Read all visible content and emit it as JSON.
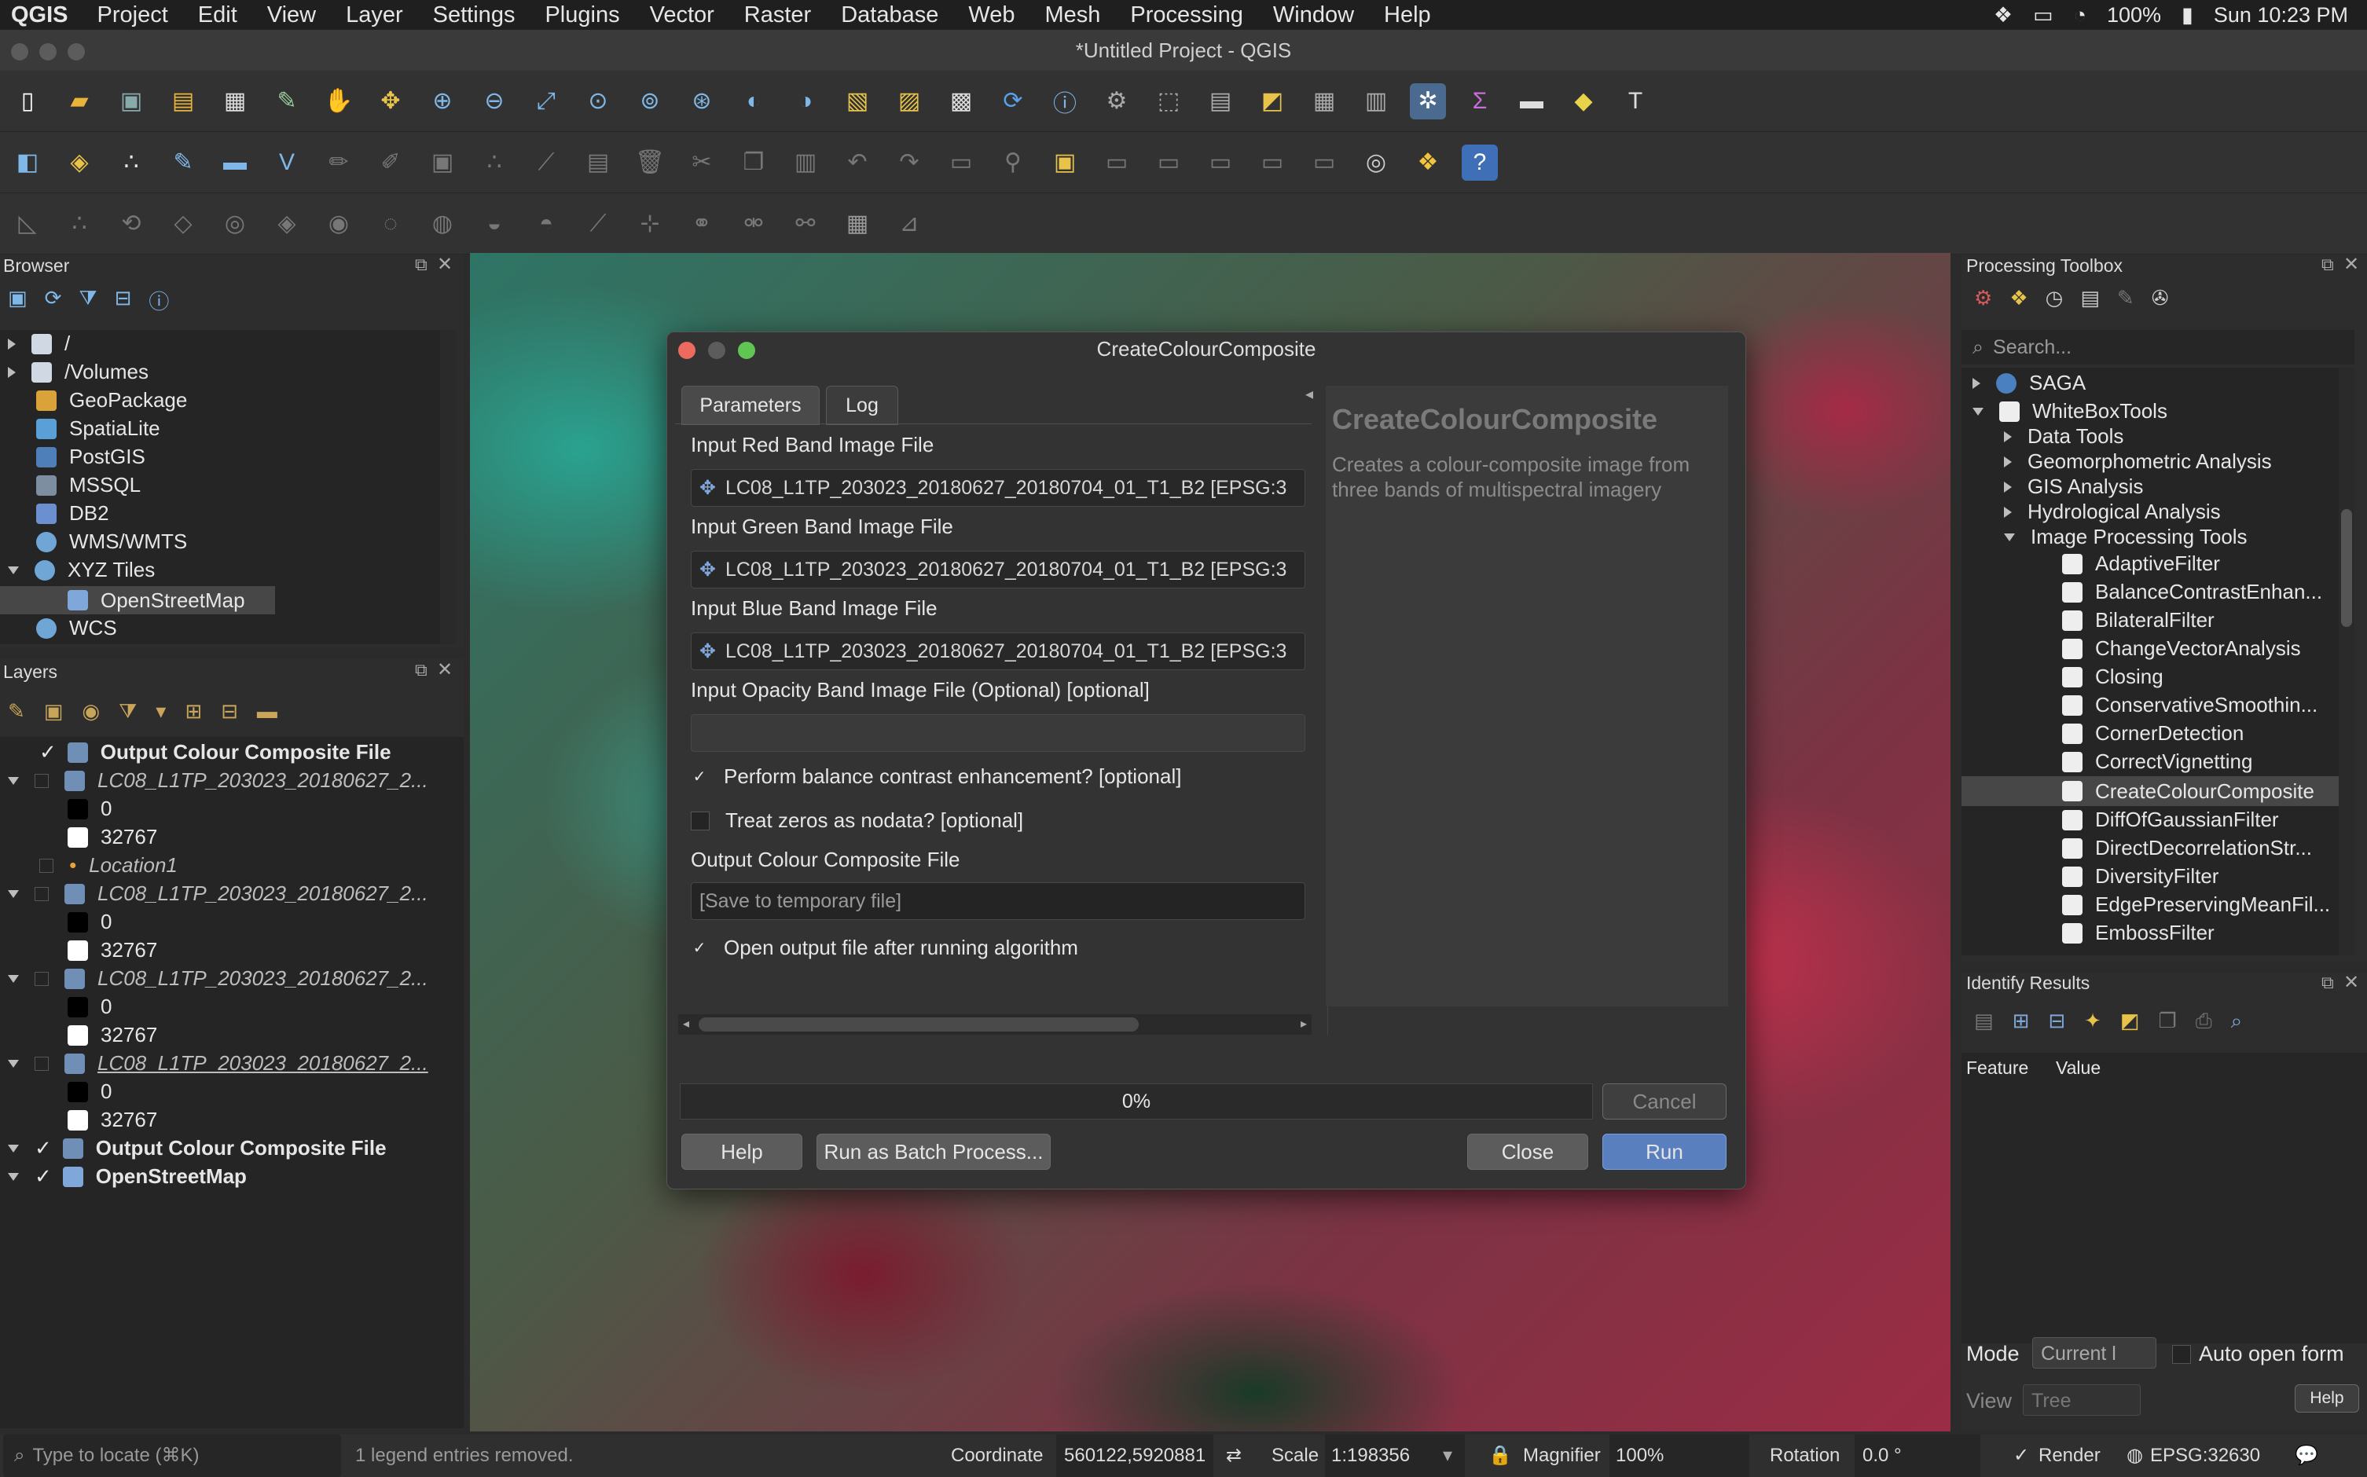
{
  "menubar": {
    "app": "QGIS",
    "items": [
      "Project",
      "Edit",
      "View",
      "Layer",
      "Settings",
      "Plugins",
      "Vector",
      "Raster",
      "Database",
      "Web",
      "Mesh",
      "Processing",
      "Window",
      "Help"
    ],
    "battery": "100%",
    "clock": "Sun 10:23 PM"
  },
  "window": {
    "title": "*Untitled Project - QGIS"
  },
  "browser": {
    "title": "Browser",
    "items": [
      {
        "label": "/",
        "icon": "folder-icon",
        "color": "#cfd8e3"
      },
      {
        "label": "/Volumes",
        "icon": "folder-icon",
        "color": "#cfd8e3"
      },
      {
        "label": "GeoPackage",
        "icon": "geopackage-icon",
        "color": "#d9a33a"
      },
      {
        "label": "SpatiaLite",
        "icon": "spatialite-icon",
        "color": "#5aa0d8"
      },
      {
        "label": "PostGIS",
        "icon": "postgis-icon",
        "color": "#4e7fb9"
      },
      {
        "label": "MSSQL",
        "icon": "mssql-icon",
        "color": "#7d8ea0"
      },
      {
        "label": "DB2",
        "icon": "db2-icon",
        "color": "#6b8fcf"
      },
      {
        "label": "WMS/WMTS",
        "icon": "globe-icon",
        "color": "#6fa6d6"
      },
      {
        "label": "XYZ Tiles",
        "icon": "globe-icon",
        "color": "#6fa6d6"
      },
      {
        "label": "OpenStreetMap",
        "icon": "tiles-icon",
        "color": "#7fa7d9"
      },
      {
        "label": "WCS",
        "icon": "globe-icon",
        "color": "#6fa6d6"
      }
    ]
  },
  "layers": {
    "title": "Layers",
    "items": [
      {
        "label": "Output Colour Composite File",
        "checked": true,
        "style": "bold"
      },
      {
        "label": "LC08_L1TP_203023_20180627_2...",
        "checked": false,
        "style": "italic"
      },
      {
        "label": "0",
        "swatch": "#000000"
      },
      {
        "label": "32767",
        "swatch": "#ffffff"
      },
      {
        "label": "Location1",
        "checked": false,
        "style": "italic"
      },
      {
        "label": "LC08_L1TP_203023_20180627_2...",
        "checked": false,
        "style": "italic"
      },
      {
        "label": "0",
        "swatch": "#000000"
      },
      {
        "label": "32767",
        "swatch": "#ffffff"
      },
      {
        "label": "LC08_L1TP_203023_20180627_2...",
        "checked": false,
        "style": "italic"
      },
      {
        "label": "0",
        "swatch": "#000000"
      },
      {
        "label": "32767",
        "swatch": "#ffffff"
      },
      {
        "label": "LC08_L1TP_203023_20180627_2...",
        "checked": false,
        "style": "italic"
      },
      {
        "label": "0",
        "swatch": "#000000"
      },
      {
        "label": "32767",
        "swatch": "#ffffff"
      },
      {
        "label": "Output Colour Composite File",
        "checked": true,
        "style": "bold"
      },
      {
        "label": "OpenStreetMap",
        "checked": true,
        "style": "bold"
      }
    ]
  },
  "dialog": {
    "title": "CreateColourComposite",
    "tabs": [
      "Parameters",
      "Log"
    ],
    "fields": {
      "red_label": "Input Red Band Image File",
      "red_value": "LC08_L1TP_203023_20180627_20180704_01_T1_B2 [EPSG:3",
      "green_label": "Input Green Band Image File",
      "green_value": "LC08_L1TP_203023_20180627_20180704_01_T1_B2 [EPSG:3",
      "blue_label": "Input Blue Band Image File",
      "blue_value": "LC08_L1TP_203023_20180627_20180704_01_T1_B2 [EPSG:3",
      "opacity_label": "Input Opacity Band Image File (Optional) [optional]",
      "balance_label": "Perform balance contrast enhancement? [optional]",
      "zeros_label": "Treat zeros as nodata? [optional]",
      "output_label": "Output Colour Composite File",
      "output_placeholder": "[Save to temporary file]",
      "open_label": "Open output file after running algorithm"
    },
    "help_title": "CreateColourComposite",
    "help_text": "Creates a colour-composite image from three bands of multispectral imagery",
    "progress": "0%",
    "buttons": {
      "cancel": "Cancel",
      "help": "Help",
      "batch": "Run as Batch Process...",
      "close": "Close",
      "run": "Run"
    }
  },
  "toolbox": {
    "title": "Processing Toolbox",
    "search_placeholder": "Search...",
    "providers": [
      "SAGA",
      "WhiteBoxTools"
    ],
    "groups": [
      "Data Tools",
      "Geomorphometric Analysis",
      "GIS Analysis",
      "Hydrological Analysis",
      "Image Processing Tools"
    ],
    "tools": [
      "AdaptiveFilter",
      "BalanceContrastEnhan...",
      "BilateralFilter",
      "ChangeVectorAnalysis",
      "Closing",
      "ConservativeSmoothin...",
      "CornerDetection",
      "CorrectVignetting",
      "CreateColourComposite",
      "DiffOfGaussianFilter",
      "DirectDecorrelationStr...",
      "DiversityFilter",
      "EdgePreservingMeanFil...",
      "EmbossFilter"
    ],
    "selected": "CreateColourComposite"
  },
  "identify": {
    "title": "Identify Results",
    "col_feature": "Feature",
    "col_value": "Value",
    "mode_label": "Mode",
    "mode_value": "Current l",
    "auto_open": "Auto open form",
    "view_label": "View",
    "view_value": "Tree",
    "help": "Help"
  },
  "statusbar": {
    "locate_placeholder": "Type to locate (⌘K)",
    "message": "1 legend entries removed.",
    "coordinate_label": "Coordinate",
    "coordinate_value": "560122,5920881",
    "scale_label": "Scale",
    "scale_value": "1:198356",
    "magnifier_label": "Magnifier",
    "magnifier_value": "100%",
    "rotation_label": "Rotation",
    "rotation_value": "0.0 °",
    "render_label": "Render",
    "epsg": "EPSG:32630"
  }
}
